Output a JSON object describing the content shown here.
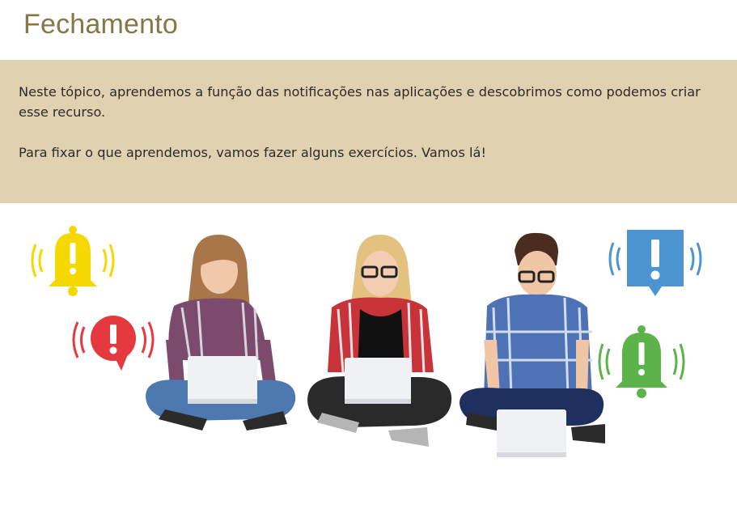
{
  "page": {
    "title": "Fechamento"
  },
  "summary": {
    "paragraph_1": "Neste tópico, aprendemos a função das notificações nas aplicações e descobrimos como podemos criar esse recurso.",
    "paragraph_2": "Para fixar o que aprendemos, vamos fazer alguns exercícios. Vamos lá!"
  },
  "illustration": {
    "icons": [
      {
        "name": "bell-icon",
        "color": "#f5d800"
      },
      {
        "name": "alert-bubble-icon",
        "color": "#e3393f"
      },
      {
        "name": "alert-square-icon",
        "color": "#4d95d2"
      },
      {
        "name": "bell-icon",
        "color": "#5bb349"
      }
    ],
    "people": [
      "person-left",
      "person-middle",
      "person-right"
    ]
  },
  "colors": {
    "title": "#857748",
    "summary_background": "#e0d2b0",
    "body_text": "#2b2b2b"
  }
}
